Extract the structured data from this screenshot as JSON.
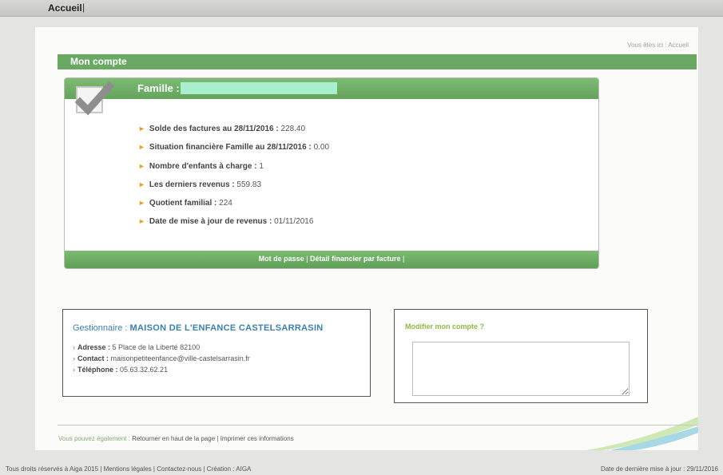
{
  "topnav": {
    "home": "Accueil",
    "separator": "|"
  },
  "breadcrumb": "Vous êtes ici : Accueil",
  "account_section": {
    "title": "Mon compte"
  },
  "family_card": {
    "title": "Famille :",
    "name_redacted": "████████████",
    "rows": [
      {
        "label": "Solde des factures au 28/11/2016 :",
        "value": " 228.40"
      },
      {
        "label": "Situation financière Famille au 28/11/2016 :",
        "value": " 0.00"
      },
      {
        "label": "Nombre d'enfants à charge :",
        "value": " 1"
      },
      {
        "label": "Les derniers revenus :",
        "value": " 559.83"
      },
      {
        "label": "Quotient familial :",
        "value": " 224"
      },
      {
        "label": "Date de mise à jour de revenus :",
        "value": " 01/11/2016"
      }
    ],
    "footer_links": [
      "Mot de passe",
      "Détail financier par facture"
    ],
    "footer_sep": "|"
  },
  "manager": {
    "prefix": "Gestionnaire : ",
    "name": "MAISON DE L'ENFANCE CASTELSARRASIN",
    "rows": [
      {
        "label": "Adresse :",
        "value": " 5 Place de la Liberté 82100"
      },
      {
        "label": "Contact :",
        "value": " maisonpetiteenfance@ville-castelsarrasin.fr"
      },
      {
        "label": "Téléphone :",
        "value": " 05.63.32.62.21"
      }
    ]
  },
  "modify_account": {
    "title": "Modifier mon compte ?",
    "textarea_value": ""
  },
  "also_bar": {
    "lead": "Vous pouvez également :",
    "link_top": "Retourner en haut de la page",
    "sep": "|",
    "link_print": "Imprimer ces informations"
  },
  "footer": {
    "rights": "Tous droits réservés à Aiga 2015",
    "sep": "|",
    "legal": "Mentions légales",
    "contact": "Contactez-nous",
    "creation": "Création : AIGA",
    "last_update": "Date de dernière mise à jour : 29/11/2016"
  },
  "colors": {
    "accent_green": "#6aa963",
    "manager_blue": "#3e7fa6",
    "bullet_orange": "#e6a321"
  },
  "icons": {
    "family_check": "checkmark-icon",
    "row_bullet": "triangle-bullet-icon"
  }
}
